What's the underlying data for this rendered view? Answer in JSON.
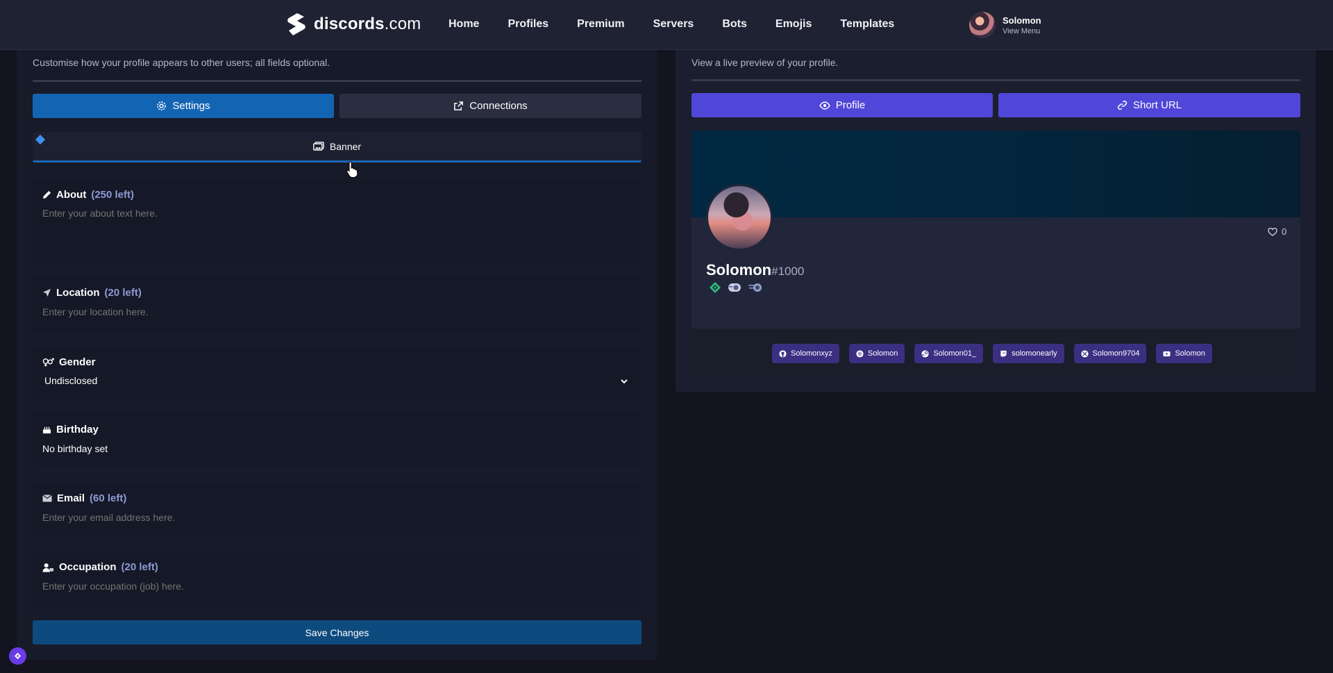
{
  "brand": {
    "name": "discords",
    "domain": ".com"
  },
  "nav": [
    "Home",
    "Profiles",
    "Premium",
    "Servers",
    "Bots",
    "Emojis",
    "Templates"
  ],
  "user": {
    "name": "Solomon",
    "menu": "View Menu"
  },
  "left": {
    "subtitle": "Customise how your profile appears to other users; all fields optional.",
    "tabs": {
      "settings": "Settings",
      "connections": "Connections"
    },
    "banner_label": "Banner",
    "fields": {
      "about": {
        "label": "About",
        "left": "(250 left)",
        "placeholder": "Enter your about text here."
      },
      "location": {
        "label": "Location",
        "left": "(20 left)",
        "placeholder": "Enter your location here."
      },
      "gender": {
        "label": "Gender",
        "value": "Undisclosed"
      },
      "birthday": {
        "label": "Birthday",
        "value": "No birthday set"
      },
      "email": {
        "label": "Email",
        "left": "(60 left)",
        "placeholder": "Enter your email address here."
      },
      "occupation": {
        "label": "Occupation",
        "left": "(20 left)",
        "placeholder": "Enter your occupation (job) here."
      }
    },
    "save_label": "Save Changes"
  },
  "right": {
    "subtitle": "View a live preview of your profile.",
    "tabs": {
      "profile": "Profile",
      "short_url": "Short URL"
    },
    "preview": {
      "username": "Solomon",
      "discriminator": "#1000",
      "likes": "0",
      "connections": [
        {
          "icon": "github-icon",
          "label": "Solomonxyz"
        },
        {
          "icon": "spotify-icon",
          "label": "Solomon"
        },
        {
          "icon": "steam-icon",
          "label": "Solomon01_"
        },
        {
          "icon": "twitch-icon",
          "label": "solomonearly"
        },
        {
          "icon": "xbox-icon",
          "label": "Solomon9704"
        },
        {
          "icon": "youtube-icon",
          "label": "Solomon"
        }
      ]
    }
  },
  "colors": {
    "accent_blue": "#1464b4",
    "accent_purple": "#5046d8",
    "chip_purple": "#3b2f82",
    "save_blue": "#0d4a7e"
  }
}
